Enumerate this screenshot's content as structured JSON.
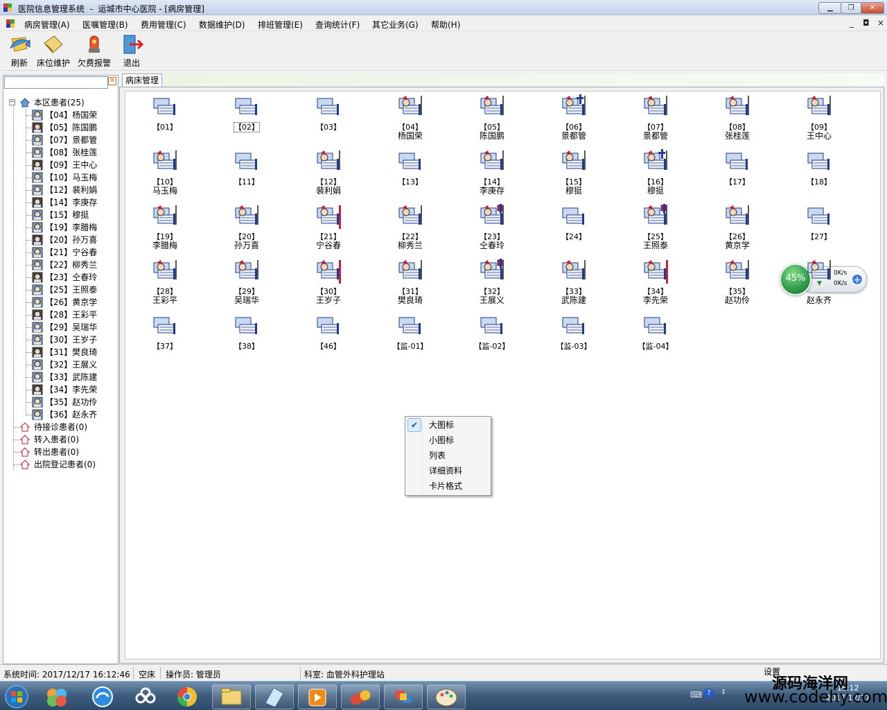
{
  "window": {
    "title": "医院信息管理系统  -  运城市中心医院 - [病房管理]",
    "min_icon": "minimize-icon",
    "max_icon": "restore-icon",
    "close_icon": "close-icon"
  },
  "menu": [
    "病房管理(A)",
    "医嘱管理(B)",
    "费用管理(C)",
    "数据维护(D)",
    "排班管理(E)",
    "查询统计(F)",
    "其它业务(G)",
    "帮助(H)"
  ],
  "mdi_controls": [
    "_",
    "◘",
    "×"
  ],
  "toolbar": [
    {
      "label": "刷新",
      "icon": "refresh-icon"
    },
    {
      "label": "床位维护",
      "icon": "bed-maintain-icon"
    },
    {
      "label": "欠费报警",
      "icon": "alarm-icon"
    },
    {
      "label": "退出",
      "icon": "exit-icon"
    }
  ],
  "search": {
    "value": "",
    "clear_icon": "clear-icon"
  },
  "tree": {
    "root": "本区患者(25)",
    "patients": [
      "【04】杨国荣",
      "【05】陈国鹏",
      "【07】景都管",
      "【08】张桂莲",
      "【09】王中心",
      "【10】马玉梅",
      "【12】裴利娟",
      "【14】李庚存",
      "【15】穆挺",
      "【19】李腊梅",
      "【20】孙万喜",
      "【21】宁谷春",
      "【22】柳秀兰",
      "【23】仝春玲",
      "【25】王照泰",
      "【26】黄京学",
      "【28】王彩平",
      "【29】吴瑞华",
      "【30】王岁子",
      "【31】樊良琦",
      "【32】王展义",
      "【33】武陈建",
      "【34】李先荣",
      "【35】赵功伶",
      "【36】赵永齐"
    ],
    "groups": [
      "待接诊患者(0)",
      "转入患者(0)",
      "转出患者(0)",
      "出院登记患者(0)"
    ]
  },
  "tab": {
    "label": "病床管理"
  },
  "beds": [
    {
      "no": "【01】",
      "name": "",
      "status": "empty"
    },
    {
      "no": "【02】",
      "name": "",
      "status": "empty",
      "selected": true
    },
    {
      "no": "【03】",
      "name": "",
      "status": "empty"
    },
    {
      "no": "【04】",
      "name": "杨国荣",
      "status": "occupied"
    },
    {
      "no": "【05】",
      "name": "陈国鹏",
      "status": "occupied"
    },
    {
      "no": "【06】",
      "name": "景都管",
      "status": "iv"
    },
    {
      "no": "【07】",
      "name": "景都管",
      "status": "occupied"
    },
    {
      "no": "【08】",
      "name": "张桂莲",
      "status": "occupied"
    },
    {
      "no": "【09】",
      "name": "王中心",
      "status": "occupied"
    },
    {
      "no": "【10】",
      "name": "马玉梅",
      "status": "occupied"
    },
    {
      "no": "【11】",
      "name": "",
      "status": "empty"
    },
    {
      "no": "【12】",
      "name": "裴利娟",
      "status": "occupied"
    },
    {
      "no": "【13】",
      "name": "",
      "status": "empty"
    },
    {
      "no": "【14】",
      "name": "李庚存",
      "status": "occupied"
    },
    {
      "no": "【15】",
      "name": "穆挺",
      "status": "occupied"
    },
    {
      "no": "【16】",
      "name": "穆挺",
      "status": "iv"
    },
    {
      "no": "【17】",
      "name": "",
      "status": "empty"
    },
    {
      "no": "【18】",
      "name": "",
      "status": "empty"
    },
    {
      "no": "【19】",
      "name": "李腊梅",
      "status": "occupied"
    },
    {
      "no": "【20】",
      "name": "孙万喜",
      "status": "occupied"
    },
    {
      "no": "【21】",
      "name": "宁谷春",
      "status": "alert"
    },
    {
      "no": "【22】",
      "name": "柳秀兰",
      "status": "occupied"
    },
    {
      "no": "【23】",
      "name": "仝春玲",
      "status": "critical"
    },
    {
      "no": "【24】",
      "name": "",
      "status": "empty"
    },
    {
      "no": "【25】",
      "name": "王照泰",
      "status": "critical"
    },
    {
      "no": "【26】",
      "name": "黄京学",
      "status": "occupied"
    },
    {
      "no": "【27】",
      "name": "",
      "status": "empty"
    },
    {
      "no": "【28】",
      "name": "王彩平",
      "status": "occupied"
    },
    {
      "no": "【29】",
      "name": "吴瑞华",
      "status": "occupied"
    },
    {
      "no": "【30】",
      "name": "王岁子",
      "status": "alert"
    },
    {
      "no": "【31】",
      "name": "樊良琦",
      "status": "occupied"
    },
    {
      "no": "【32】",
      "name": "王展义",
      "status": "critical"
    },
    {
      "no": "【33】",
      "name": "武陈建",
      "status": "occupied"
    },
    {
      "no": "【34】",
      "name": "李先荣",
      "status": "alert"
    },
    {
      "no": "【35】",
      "name": "赵功伶",
      "status": "occupied"
    },
    {
      "no": "",
      "name": "赵永齐",
      "status": "occupied"
    },
    {
      "no": "【37】",
      "name": "",
      "status": "empty"
    },
    {
      "no": "【38】",
      "name": "",
      "status": "empty"
    },
    {
      "no": "【46】",
      "name": "",
      "status": "empty"
    },
    {
      "no": "【监-01】",
      "name": "",
      "status": "empty"
    },
    {
      "no": "【监-02】",
      "name": "",
      "status": "empty"
    },
    {
      "no": "【监-03】",
      "name": "",
      "status": "empty"
    },
    {
      "no": "【监-04】",
      "name": "",
      "status": "empty"
    }
  ],
  "context_menu": {
    "items": [
      "大图标",
      "小图标",
      "列表",
      "详细资料",
      "卡片格式"
    ],
    "checked": "大图标",
    "check_icon": "checkmark-icon"
  },
  "net_widget": {
    "percent": "45%",
    "up": "0K/s",
    "down": "0K/s",
    "add_icon": "plus-icon"
  },
  "status": {
    "time": "系统时间: 2017/12/17 16:12:46",
    "bed": "空床",
    "operator": "操作员: 管理员",
    "dept": "科室: 血管外科护理站",
    "settings": "设置"
  },
  "taskbar": {
    "icons": [
      "start-orb-icon",
      "app-colorful-icon",
      "refresh-blue-icon",
      "cloud-drive-icon",
      "browser-icon",
      "folder-icon",
      "notepad-icon",
      "media-player-icon",
      "capsule-icon",
      "paint-windows-icon",
      "palette-icon"
    ],
    "clock_time": "16:12",
    "clock_date": "2017/12/17"
  },
  "watermark": {
    "line1": "源码海洋网",
    "line2": "www.codehy.com"
  },
  "colors": {
    "accent": "#2c6fb4",
    "titlebar": "#c4d4ea",
    "alert": "#c81d3b",
    "tab_strip": "#eaf5e4",
    "widget_green": "#2f9a4a"
  }
}
